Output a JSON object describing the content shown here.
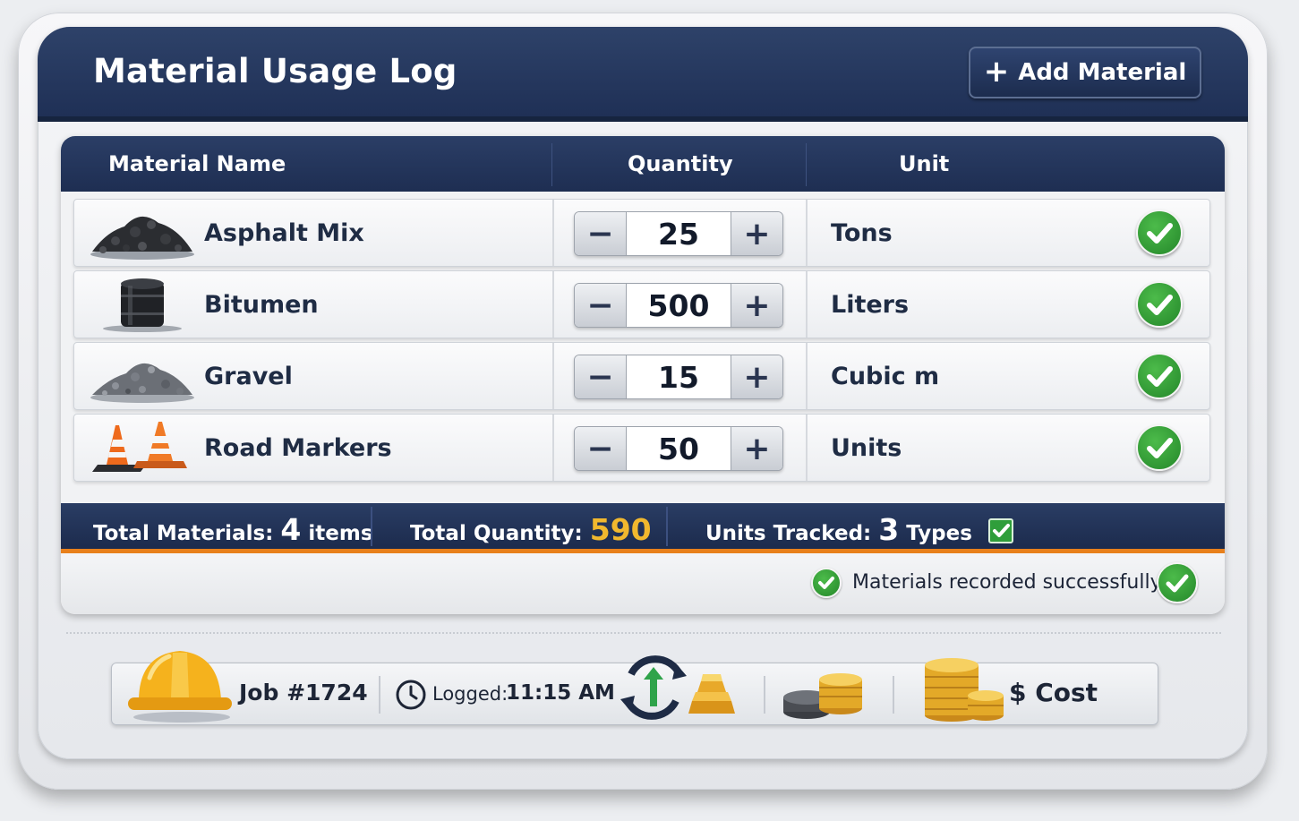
{
  "header": {
    "title": "Material Usage Log",
    "add_button_label": "Add Material",
    "add_icon": "plus-icon"
  },
  "table": {
    "columns": [
      "Material Name",
      "Quantity",
      "Unit"
    ],
    "rows": [
      {
        "name": "Asphalt Mix",
        "quantity": "25",
        "unit": "Tons",
        "icon": "asphalt-pile-icon",
        "status": "check-icon"
      },
      {
        "name": "Bitumen",
        "quantity": "500",
        "unit": "Liters",
        "icon": "barrel-icon",
        "status": "check-icon"
      },
      {
        "name": "Gravel",
        "quantity": "15",
        "unit": "Cubic m",
        "icon": "gravel-pile-icon",
        "status": "check-icon"
      },
      {
        "name": "Road Markers",
        "quantity": "50",
        "unit": "Units",
        "icon": "traffic-cone-icon",
        "status": "check-icon"
      }
    ],
    "stepper_minus": "−",
    "stepper_plus": "+"
  },
  "summary": {
    "total_materials_label": "Total Materials:",
    "total_materials_value": "4",
    "total_materials_suffix": "items",
    "total_quantity_label": "Total Quantity:",
    "total_quantity_value": "590",
    "units_tracked_label": "Units Tracked:",
    "units_tracked_value": "3",
    "units_tracked_suffix": "Types",
    "accent_color": "#e8801c",
    "highlight_color": "#f1b82e"
  },
  "status": {
    "message": "Materials recorded successfully"
  },
  "footer": {
    "job_label": "Job #1724",
    "logged_label": "Logged:",
    "logged_time": "11:15 AM",
    "cost_label": "$ Cost",
    "icons": [
      "hard-hat-icon",
      "clock-icon",
      "exchange-icon",
      "gold-bars-icon",
      "coins-stack-icon",
      "coin-pile-icon"
    ]
  },
  "colors": {
    "navy": "#1f3056",
    "success_green": "#2f9e3b"
  }
}
